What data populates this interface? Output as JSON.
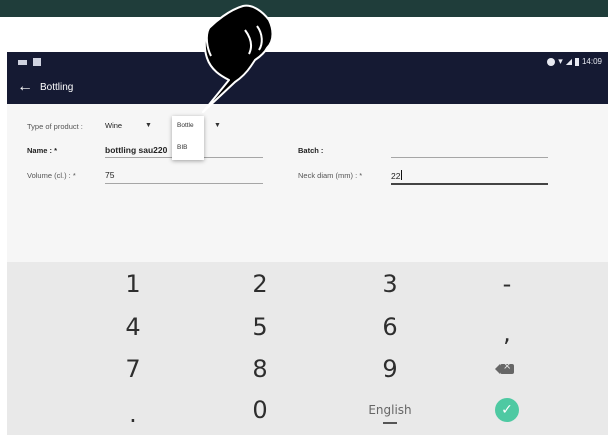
{
  "status_bar": {
    "time": "14:09"
  },
  "app_bar": {
    "title": "Bottling"
  },
  "form": {
    "type_of_product_label": "Type of product :",
    "type_value": "Wine",
    "dropdown_options": [
      "Bottle",
      "BIB"
    ],
    "name_label": "Name : *",
    "name_value": "bottling sau220",
    "batch_label": "Batch :",
    "batch_value": "",
    "volume_label": "Volume (cl.) : *",
    "volume_value": "75",
    "neck_label": "Neck diam (mm) : *",
    "neck_value": "22"
  },
  "keyboard": {
    "rows": [
      [
        "1",
        "2",
        "3",
        "-"
      ],
      [
        "4",
        "5",
        "6",
        ","
      ],
      [
        "7",
        "8",
        "9",
        "delete-icon"
      ],
      [
        ".",
        "0",
        "English",
        "done-icon"
      ]
    ]
  },
  "colors": {
    "app_bar": "#151a33",
    "accent": "#4ec9a2",
    "banner": "#1f3d3a"
  }
}
